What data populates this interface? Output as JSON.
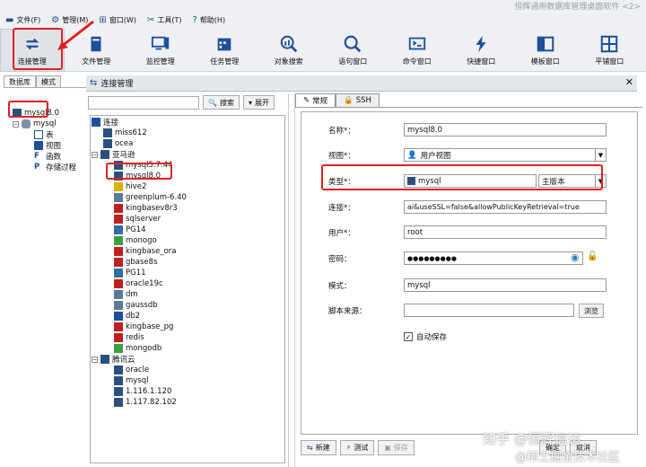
{
  "window_title": "恒辉通用数据库管理桌面软件 <2>",
  "menu": [
    {
      "label": "文件(F)",
      "icon": "folder-icon"
    },
    {
      "label": "管理(M)",
      "icon": "gear-icon"
    },
    {
      "label": "窗口(W)",
      "icon": "windows-icon"
    },
    {
      "label": "工具(T)",
      "icon": "tools-icon"
    },
    {
      "label": "帮助(H)",
      "icon": "help-icon"
    }
  ],
  "toolbar": [
    {
      "label": "连接管理",
      "icon": "connect-icon"
    },
    {
      "label": "文件管理",
      "icon": "book-icon"
    },
    {
      "label": "监控管理",
      "icon": "monitor-icon"
    },
    {
      "label": "任务管理",
      "icon": "calendar-icon"
    },
    {
      "label": "对象搜索",
      "icon": "chart-search-icon"
    },
    {
      "label": "语句窗口",
      "icon": "magnifier-icon"
    },
    {
      "label": "命令窗口",
      "icon": "terminal-icon"
    },
    {
      "label": "快捷窗口",
      "icon": "lightning-icon"
    },
    {
      "label": "模板窗口",
      "icon": "template-icon"
    },
    {
      "label": "平铺窗口",
      "icon": "grid-icon"
    }
  ],
  "left_panel": {
    "tabs": [
      "数据库",
      "模式"
    ],
    "root": "mysql8.0",
    "db": "mysql",
    "items": [
      "表",
      "视图",
      "函数",
      "存储过程"
    ]
  },
  "conn_manager": {
    "title": "连接管理",
    "search_button": "搜索",
    "expand_button": "展开",
    "tree": {
      "root": "连接",
      "top": [
        "miss612",
        "ocea"
      ],
      "group1": "亚马逊",
      "group1_items": [
        "mysql5.7.44",
        "mysql8.0",
        "hive2",
        "greenplum-6.40",
        "kingbasev8r3",
        "sqlserver",
        "PG14",
        "monogo",
        "kingbase_ora",
        "gbase8s",
        "PG11",
        "oracle19c",
        "dm",
        "gaussdb",
        "db2",
        "kingbase_pg",
        "redis",
        "mongodb"
      ],
      "group2": "腾讯云",
      "group2_items": [
        "oracle",
        "mysql",
        "1.116.1.120",
        "1.117.82.102"
      ]
    }
  },
  "form": {
    "tabs": [
      "常规",
      "SSH"
    ],
    "labels": {
      "name": "名称*：",
      "view": "视图*：",
      "type": "类型*：",
      "conn": "连接*：",
      "user": "用户*：",
      "pwd": "密码：",
      "schema": "模式：",
      "script": "脚本来源："
    },
    "name": "mysql8.0",
    "view": "用户视图",
    "type": "mysql",
    "type_version": "主版本",
    "conn": "ai&useSSL=false&allowPublicKeyRetrieval=true",
    "user": "root",
    "pwd": "●●●●●●●●●",
    "schema": "mysql",
    "script": "",
    "browse": "浏览",
    "autosave": "自动保存"
  },
  "buttons": {
    "new": "新建",
    "test": "测试",
    "save": "保存",
    "confirm": "确定",
    "cancel": "取消"
  },
  "watermark": {
    "line1": "知乎 @恒辉信达",
    "line2": "@稀土掘金技术社区"
  },
  "colors": {
    "highlight": "#e02020",
    "icon_blue": "#1f4f9a"
  }
}
